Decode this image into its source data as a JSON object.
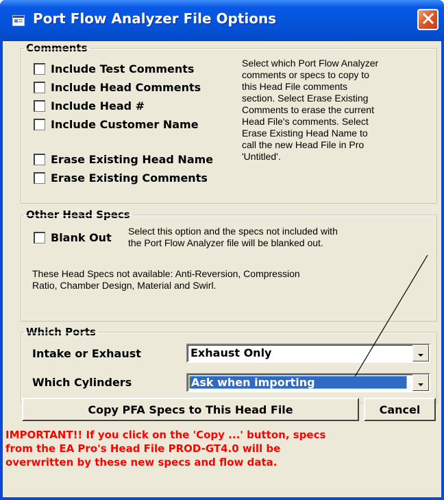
{
  "window": {
    "title": "Port Flow Analyzer File Options",
    "icon": "app-window-icon",
    "close_icon": "close-icon",
    "accent_color": "#0858e6",
    "close_color": "#e05a2a"
  },
  "comments": {
    "legend": "Comments",
    "checkboxes": [
      {
        "label": "Include Test Comments",
        "checked": false
      },
      {
        "label": "Include Head Comments",
        "checked": false
      },
      {
        "label": "Include Head #",
        "checked": false
      },
      {
        "label": "Include Customer Name",
        "checked": false
      },
      {
        "label": "Erase Existing Head Name",
        "checked": false
      },
      {
        "label": "Erase Existing Comments",
        "checked": false
      }
    ],
    "description_lines": [
      "Select which Port Flow Analyzer",
      "comments or specs to copy to",
      "this Head File comments",
      "section.  Select Erase Existing",
      "Comments to erase the current",
      "Head File's comments.  Select",
      "Erase Existing Head Name to",
      "call the new Head File in Pro",
      "'Untitled'."
    ]
  },
  "other_specs": {
    "legend": "Other Head Specs",
    "blank_out_label": "Blank Out",
    "blank_out_checked": false,
    "blank_out_desc_lines": [
      "Select this option and the specs not included with",
      "the Port Flow Analyzer file will be blanked out."
    ],
    "not_available_lines": [
      "These Head Specs not available:  Anti-Reversion, Compression",
      "Ratio, Chamber Design, Material and Swirl."
    ]
  },
  "ports": {
    "legend": "Which Ports",
    "intake_label": "Intake or Exhaust",
    "intake_value": "Exhaust Only",
    "cylinders_label": "Which Cylinders",
    "cylinders_value": "Ask when importing"
  },
  "buttons": {
    "copy_label": "Copy PFA Specs to This Head File",
    "cancel_label": "Cancel"
  },
  "warning": {
    "lines": [
      "IMPORTANT!!  If you click on the 'Copy ...' button, specs",
      "from the EA Pro's Head File PROD-GT4.0 will be",
      "overwritten by these new specs and flow data."
    ],
    "color": "#ff0000"
  }
}
